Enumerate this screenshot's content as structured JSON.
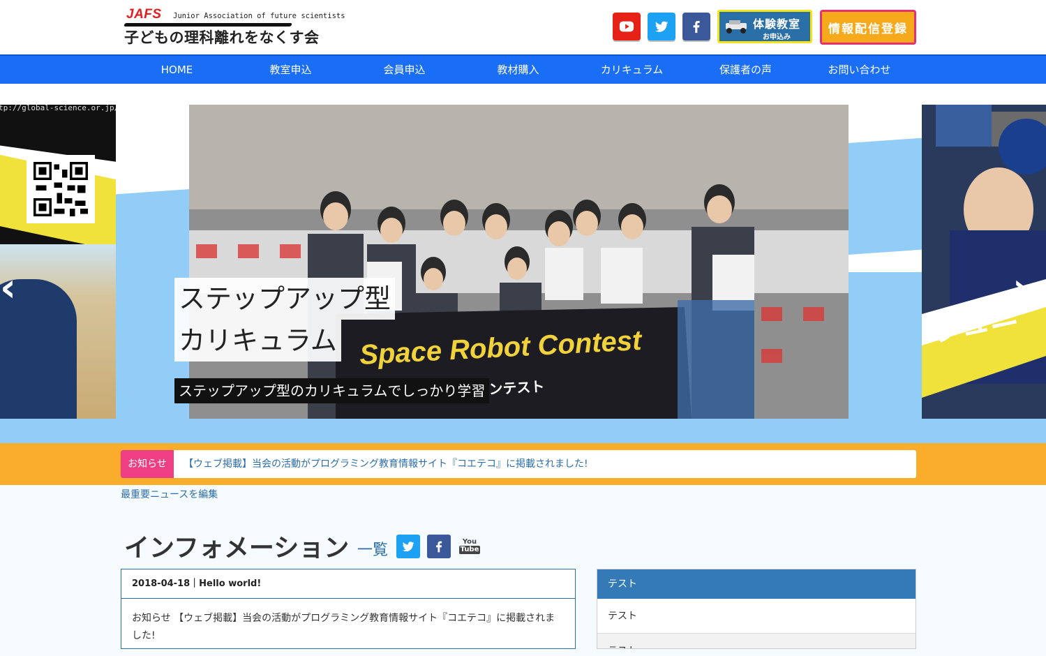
{
  "brand": {
    "jafs": "JAFS",
    "english": "Junior Association of future scientists",
    "japanese": "子どもの理科離れをなくす会"
  },
  "header_buttons": {
    "trial_line1": "体験教室",
    "trial_line2": "お申込み",
    "info_register": "情報配信登録"
  },
  "nav": [
    "HOME",
    "教室申込",
    "会員申込",
    "教材購入",
    "カリキュラム",
    "保護者の声",
    "お問い合わせ"
  ],
  "hero": {
    "title_line1": "ステップアップ型",
    "title_line2": "カリキュラム",
    "subtitle": "ステップアップ型のカリキュラムでしっかり学習",
    "left_url": "tp://global-science.or.jp/",
    "banner_text": "Space Robot Contest",
    "banner_jp": "ロボットコンテスト",
    "prev_arrow": "‹",
    "next_arrow": "›"
  },
  "notice": {
    "label": "お知らせ",
    "text": "【ウェブ掲載】当会の活動がプログラミング教育情報サイト『コエテコ』に掲載されました!"
  },
  "edit_link": "最重要ニュースを編集",
  "information": {
    "title": "インフォメーション",
    "list_link": "一覧",
    "youtube_top": "You",
    "youtube_bottom": "Tube"
  },
  "post": {
    "header": "2018-04-18｜Hello world!",
    "body": "お知らせ 【ウェブ掲載】当会の活動がプログラミング教育情報サイト『コエテコ』に掲載されました!"
  },
  "sidebar": {
    "heading": "テスト",
    "items": [
      "テスト",
      "テスト"
    ]
  },
  "colors": {
    "nav_blue": "#1a6ef5",
    "notice_orange": "#f9ad2b",
    "notice_pink": "#ee3f85",
    "link_blue": "#2d6ea8",
    "youtube_red": "#e62117",
    "twitter_blue": "#1da1f2",
    "facebook_blue": "#3b5998"
  },
  "icons": [
    "youtube-icon",
    "twitter-icon",
    "facebook-icon",
    "robot-car-icon",
    "qr-code-icon"
  ]
}
